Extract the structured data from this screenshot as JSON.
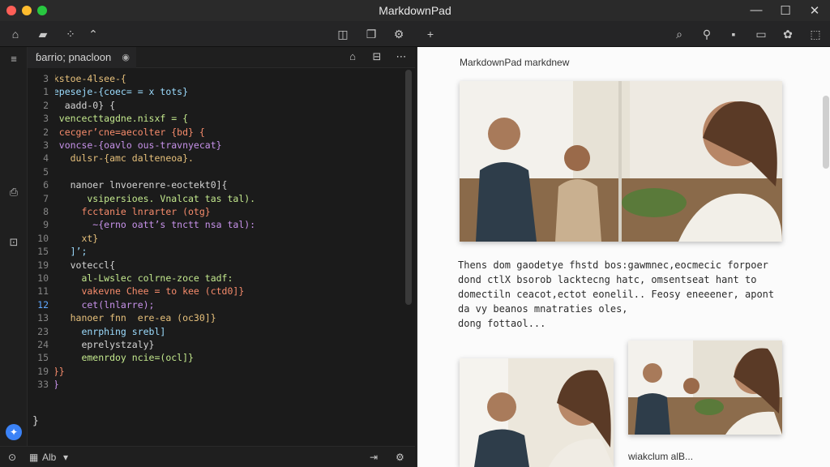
{
  "window": {
    "title": "MarkdownPad"
  },
  "tab": {
    "label": "ɓarrio; pnacloon"
  },
  "gutter": [
    "3",
    "1",
    "2",
    "3",
    "2",
    "3",
    "4",
    "5",
    "6",
    "7",
    "8",
    "9",
    "10",
    "15",
    "19",
    "10",
    "11",
    "12",
    "13",
    "23",
    "24",
    "15",
    "19",
    "33"
  ],
  "code_lines": [
    "makstoe-4lsee-{",
    "  epeseje-{coec= = x tots}",
    "    aadd-0} {",
    "   vencecttagdne.nisxf = {",
    "   cecger’cne=aecolter {bd} {",
    "   voncse-{oavlo ous-travnyecat}",
    "     dulsr-{amc dalteneoa}.",
    "",
    "     nanoer lnvoerenre-eoctekt0]{",
    "        vsipersioes. Vnalcat tas tal).",
    "       fcctanie lnrarter (otg}",
    "         ~{erno oatt’s tnctt nsa tal):",
    "       xt}",
    "     ]’;",
    "     voteccl{",
    "       al-Lwslec colrne-zoce tadf:",
    "       vakevne Chee = to kee (ctd0]}",
    "       cet(lnlarre);",
    "     hanoer fnn  ere-ea (oc30]}",
    "       enrphing srebl]",
    "       eprelystzaly}",
    "       emenrdoy ncie=(ocl]}",
    "  }}",
    "  }",
    "}"
  ],
  "statusbar": {
    "branch": "Alb"
  },
  "preview": {
    "heading": "MarkdownPad markdnew",
    "paragraph_lines": [
      "Thens dom gaodetye fhstd bos:gawmnec,eocmecic forpoer",
      "dond ctlX bsorob lacktecng hatc, omsentseat hant to",
      "domectiln ceacot,ectot eonelil.. Feosy eneeener, apont",
      "da vy beanos mnatraties oles,",
      "dong fottaol..."
    ],
    "caption": "wiakclum alB..."
  },
  "colors": {
    "accent": "#3b82f6",
    "editor_bg": "#1b1b1b",
    "preview_bg": "#fbfbfb"
  }
}
